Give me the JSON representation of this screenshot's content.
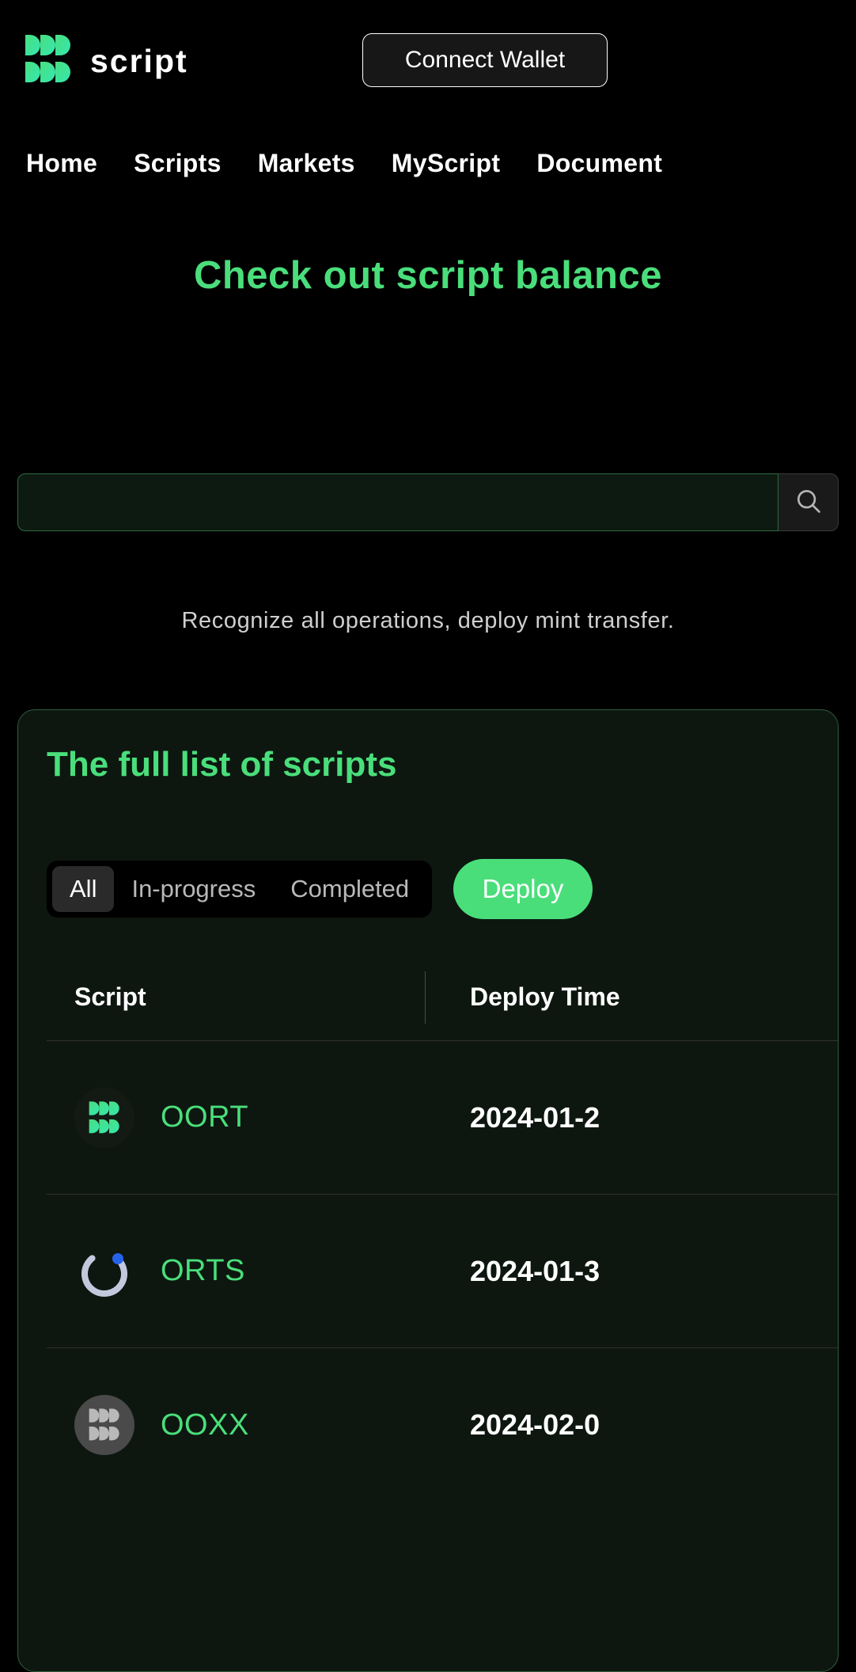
{
  "header": {
    "brand_name": "script",
    "logo_icon": "script-logo-icon",
    "connect_wallet_label": "Connect Wallet"
  },
  "nav": {
    "items": [
      {
        "label": "Home"
      },
      {
        "label": "Scripts"
      },
      {
        "label": "Markets"
      },
      {
        "label": "MyScript"
      },
      {
        "label": "Document"
      }
    ]
  },
  "hero": {
    "title": "Check out script balance",
    "subtitle": "Recognize all operations, deploy mint transfer.",
    "search": {
      "value": "",
      "placeholder": "",
      "icon": "search-icon"
    }
  },
  "card": {
    "title": "The full list of scripts",
    "tabs": [
      {
        "label": "All",
        "active": true
      },
      {
        "label": "In-progress",
        "active": false
      },
      {
        "label": "Completed",
        "active": false
      }
    ],
    "deploy_label": "Deploy",
    "table": {
      "columns": [
        {
          "label": "Script"
        },
        {
          "label": "Deploy Time"
        }
      ],
      "rows": [
        {
          "name": "OORT",
          "deploy_time": "2024-01-2",
          "icon": "script-logo-icon",
          "icon_style": "dark"
        },
        {
          "name": "ORTS",
          "deploy_time": "2024-01-3",
          "icon": "loading-spinner-icon",
          "icon_style": "plain"
        },
        {
          "name": "OOXX",
          "deploy_time": "2024-02-0",
          "icon": "script-logo-icon",
          "icon_style": "gray"
        }
      ]
    }
  },
  "colors": {
    "background": "#000000",
    "accent_green": "#4ade7b",
    "card_background": "#0d1710",
    "card_border": "#2f5f3c",
    "spinner_dot": "#2563eb"
  }
}
